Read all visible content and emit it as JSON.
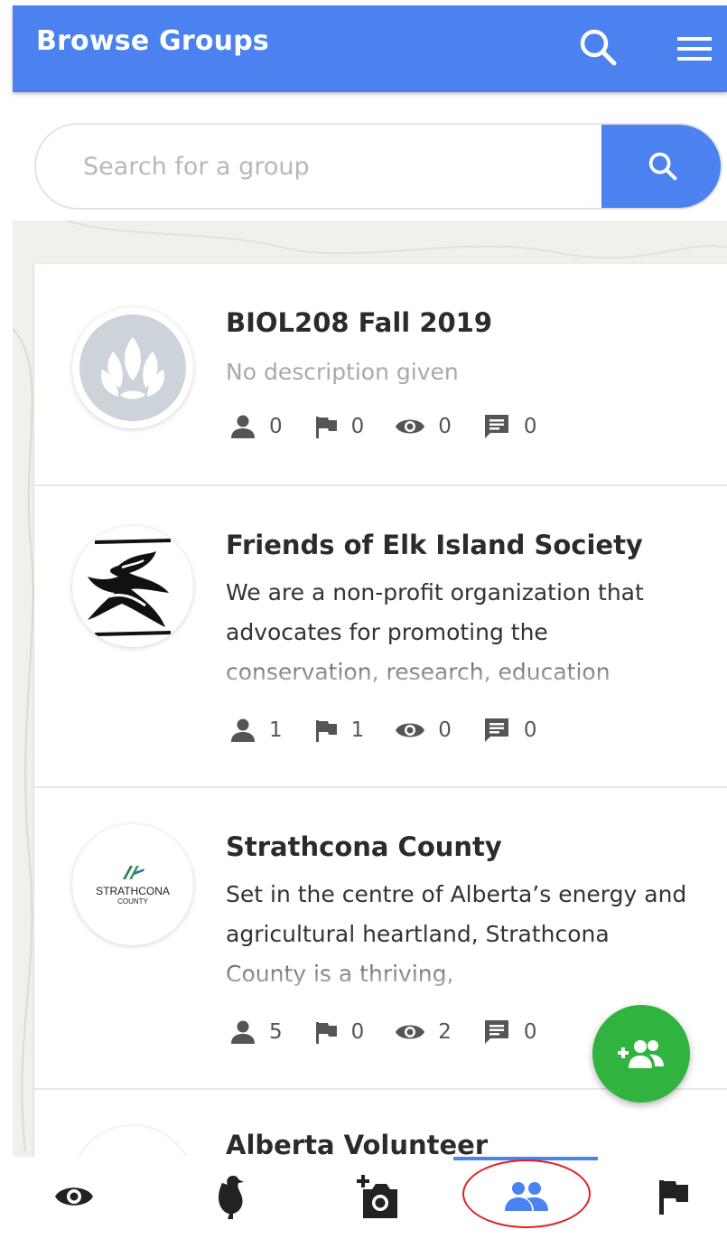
{
  "header": {
    "title": "Browse Groups"
  },
  "search": {
    "placeholder": "Search for a group",
    "value": ""
  },
  "groups": [
    {
      "title": "BIOL208 Fall 2019",
      "description": "No description given",
      "members": "0",
      "observations": "0",
      "watchers": "0",
      "comments": "0",
      "avatar": "leaf-logo"
    },
    {
      "title": "Friends of Elk Island Society",
      "description": "We are a non-profit organization that advocates for promoting the conservation, research, education",
      "members": "1",
      "observations": "1",
      "watchers": "0",
      "comments": "0",
      "avatar": "elk-island-logo"
    },
    {
      "title": "Strathcona County",
      "description": "Set in the centre of Alberta’s energy and agricultural heartland, Strathcona County is a thriving,",
      "members": "5",
      "observations": "0",
      "watchers": "2",
      "comments": "0",
      "avatar": "strathcona-logo",
      "logo_line1": "STRATHCONA",
      "logo_line2": "COUNTY"
    },
    {
      "title": "Alberta Volunteer"
    }
  ],
  "fab": {
    "icon": "add-group-icon",
    "label": "+"
  },
  "nav": {
    "items": [
      "eye-icon",
      "bird-icon",
      "add-photo-icon",
      "groups-icon",
      "flag-icon"
    ],
    "active": "groups-icon"
  },
  "colors": {
    "primary": "#4b82f0",
    "fab": "#31b33f",
    "highlight": "#e02020"
  }
}
